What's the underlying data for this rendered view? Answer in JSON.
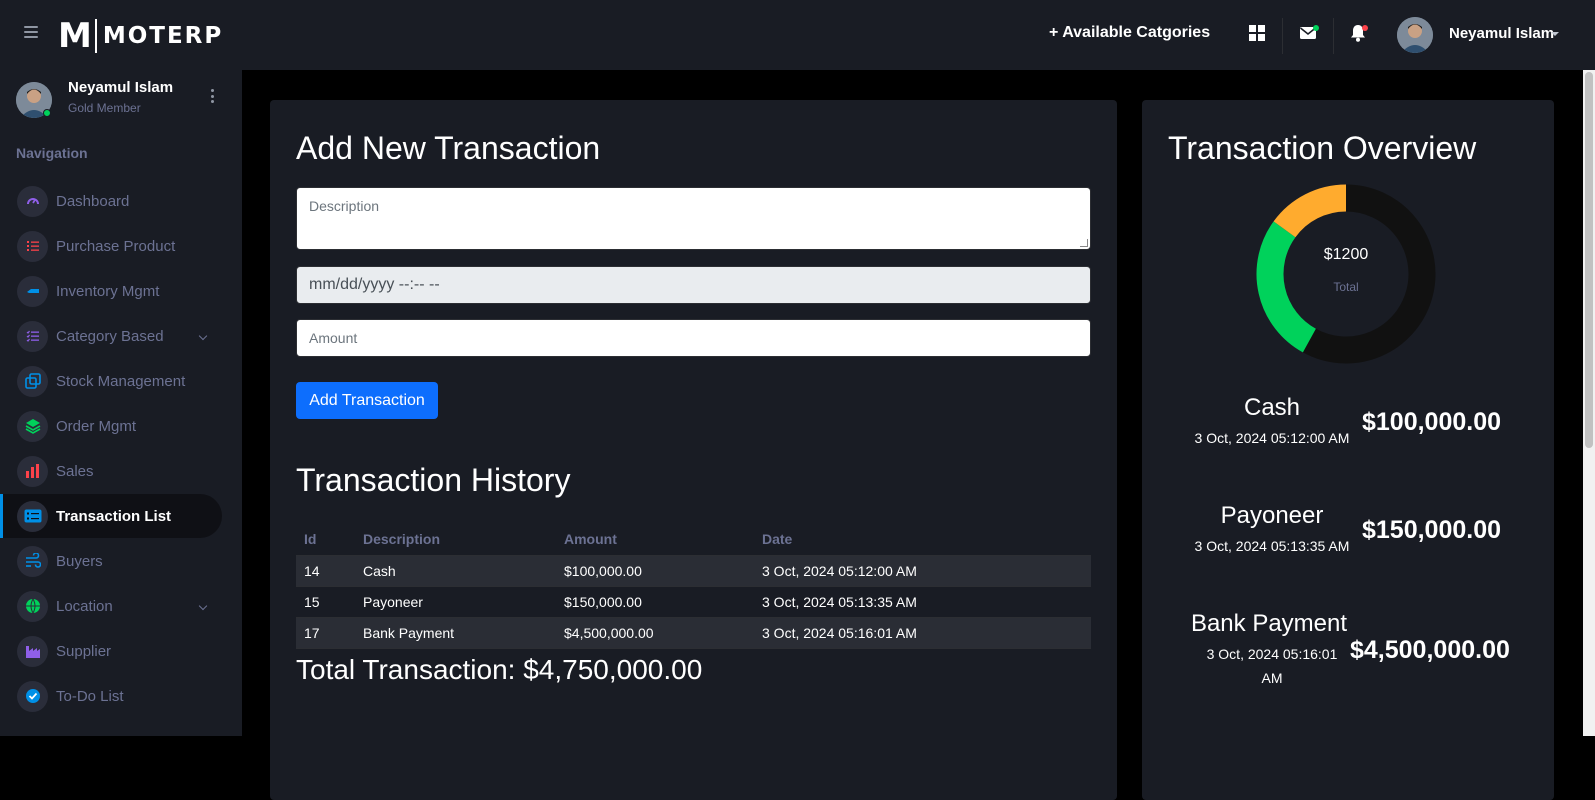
{
  "header": {
    "logo_letter": "M",
    "logo_word": "MOTERP",
    "available_categories": "+ Available Catgories",
    "user_name": "Neyamul Islam",
    "colors": {
      "message_dot": "#00d25b",
      "notification_dot": "#fc424a"
    }
  },
  "sidebar": {
    "profile": {
      "name": "Neyamul Islam",
      "role": "Gold Member"
    },
    "nav_heading": "Navigation",
    "items": [
      {
        "label": "Dashboard",
        "icon": "speedometer-icon",
        "color": "#8f5fe8"
      },
      {
        "label": "Purchase Product",
        "icon": "list-icon",
        "color": "#fc424a"
      },
      {
        "label": "Inventory Mgmt",
        "icon": "inventory-icon",
        "color": "#0090e7"
      },
      {
        "label": "Category Based",
        "icon": "checklist-icon",
        "color": "#8f5fe8",
        "has_submenu": true
      },
      {
        "label": "Stock Management",
        "icon": "copy-icon",
        "color": "#0090e7"
      },
      {
        "label": "Order Mgmt",
        "icon": "layers-icon",
        "color": "#00d25b"
      },
      {
        "label": "Sales",
        "icon": "bar-chart-icon",
        "color": "#fc424a"
      },
      {
        "label": "Transaction List",
        "icon": "card-list-icon",
        "color": "#0090e7",
        "active": true
      },
      {
        "label": "Buyers",
        "icon": "wind-icon",
        "color": "#0090e7"
      },
      {
        "label": "Location",
        "icon": "globe-icon",
        "color": "#00d25b",
        "has_submenu": true
      },
      {
        "label": "Supplier",
        "icon": "factory-icon",
        "color": "#8f5fe8"
      },
      {
        "label": "To-Do List",
        "icon": "check-badge-icon",
        "color": "#0090e7"
      }
    ]
  },
  "add_form": {
    "title": "Add New Transaction",
    "description_placeholder": "Description",
    "date_value": "mm/dd/yyyy --:-- --",
    "amount_placeholder": "Amount",
    "submit_label": "Add Transaction"
  },
  "history": {
    "title": "Transaction History",
    "columns": [
      "Id",
      "Description",
      "Amount",
      "Date"
    ],
    "rows": [
      [
        "14",
        "Cash",
        "$100,000.00",
        "3 Oct, 2024 05:12:00 AM"
      ],
      [
        "15",
        "Payoneer",
        "$150,000.00",
        "3 Oct, 2024 05:13:35 AM"
      ],
      [
        "17",
        "Bank Payment",
        "$4,500,000.00",
        "3 Oct, 2024 05:16:01 AM"
      ]
    ],
    "total": "Total Transaction: $4,750,000.00"
  },
  "overview": {
    "title": "Transaction Overview",
    "donut": {
      "center_value": "$1200",
      "center_label": "Total",
      "segments": [
        {
          "value": 0.58,
          "color": "#111111"
        },
        {
          "value": 0.27,
          "color": "#00d25b"
        },
        {
          "value": 0.15,
          "color": "#ffab2e"
        }
      ]
    },
    "entries": [
      {
        "name": "Cash",
        "date_line1": "3 Oct, 2024 05:12:00 AM",
        "date_line2": "",
        "amount": "$100,000.00"
      },
      {
        "name": "Payoneer",
        "date_line1": "3 Oct, 2024 05:13:35 AM",
        "date_line2": "",
        "amount": "$150,000.00"
      },
      {
        "name": "Bank Payment",
        "date_line1": "3 Oct, 2024 05:16:01",
        "date_line2": "AM",
        "amount": "$4,500,000.00"
      }
    ]
  }
}
